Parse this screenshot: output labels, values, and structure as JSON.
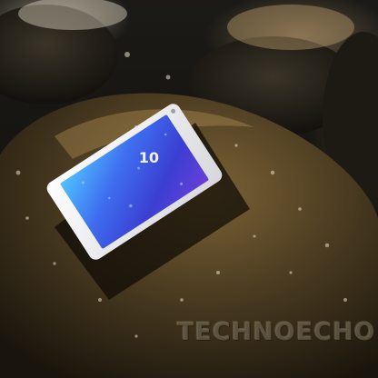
{
  "photo": {
    "phone_screen": {
      "clock": "10"
    },
    "watermark": "TECHNOECHO"
  },
  "colors": {
    "stone": "#5a4a2c",
    "screen": "#3446d8",
    "phone_body": "#f2f2f4"
  }
}
